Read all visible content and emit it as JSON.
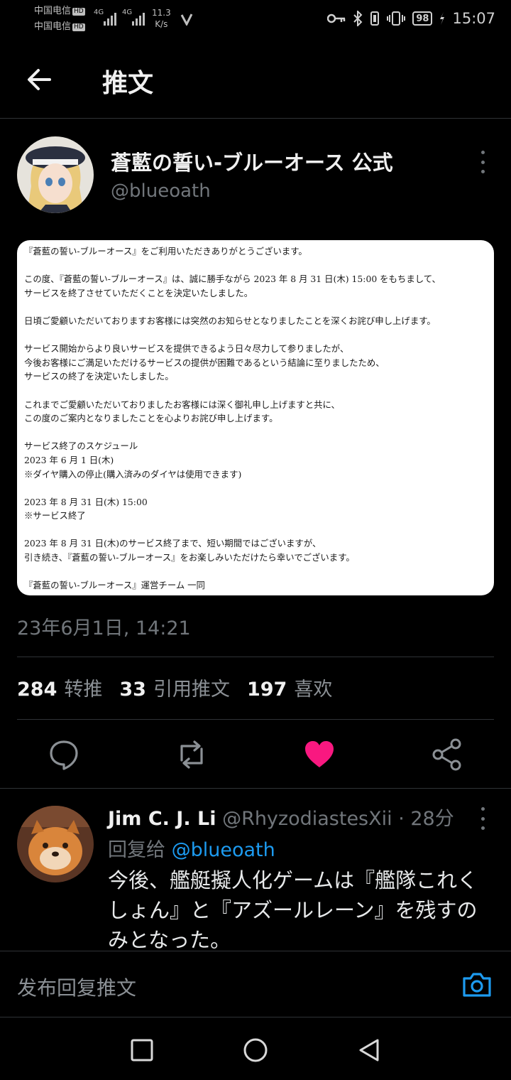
{
  "status_bar": {
    "carrier_1": "中国电信",
    "carrier_2": "中国电信",
    "hd": "HD",
    "net_1": "4G",
    "net_2": "4G",
    "speed_value": "11.3",
    "speed_unit": "K/s",
    "battery": "98",
    "time": "15:07"
  },
  "header": {
    "title": "推文"
  },
  "tweet": {
    "author_name": "蒼藍の誓い-ブルーオース 公式",
    "author_handle": "@blueoath",
    "notice_lines": [
      "『蒼藍の誓い-ブルーオース』をご利用いただきありがとうございます。",
      "",
      "この度、『蒼藍の誓い-ブルーオース』は、誠に勝手ながら 2023 年 8 月 31 日(木) 15:00 をもちまして、",
      "サービスを終了させていただくことを決定いたしました。",
      "",
      "日頃ご愛顧いただいておりますお客様には突然のお知らせとなりましたことを深くお詫び申し上げます。",
      "",
      "サービス開始からより良いサービスを提供できるよう日々尽力して参りましたが、",
      "今後お客様にご満足いただけるサービスの提供が困難であるという結論に至りましたため、",
      "サービスの終了を決定いたしました。",
      "",
      "これまでご愛顧いただいておりましたお客様には深く御礼申し上げますと共に、",
      "この度のご案内となりましたことを心よりお詫び申し上げます。",
      "",
      "サービス終了のスケジュール",
      "2023 年 6 月 1 日(木)",
      "※ダイヤ購入の停止(購入済みのダイヤは使用できます)",
      "",
      "2023 年 8 月 31 日(木) 15:00",
      "※サービス終了",
      "",
      "2023 年 8 月 31 日(木)のサービス終了まで、短い期間ではございますが、",
      "引き続き、『蒼藍の誓い-ブルーオース』をお楽しみいただけたら幸いでございます。",
      "",
      "『蒼藍の誓い-ブルーオース』運営チーム 一同"
    ],
    "timestamp": "23年6月1日, 14:21",
    "stats": {
      "retweets_count": "284",
      "retweets_label": "转推",
      "quotes_count": "33",
      "quotes_label": "引用推文",
      "likes_count": "197",
      "likes_label": "喜欢"
    }
  },
  "reply": {
    "name": "Jim C. J. Li",
    "handle_time": "@RhyzodiastesXii · 28分",
    "reply_to_label": "回复给",
    "reply_to_handle": "@blueoath",
    "text": "今後、艦艇擬人化ゲームは『艦隊これくしょん』と『アズールレーン』を残すのみとなった。"
  },
  "compose": {
    "placeholder": "发布回复推文"
  },
  "colors": {
    "like": "#f91880",
    "link": "#1d9bf0",
    "background": "#000000"
  }
}
